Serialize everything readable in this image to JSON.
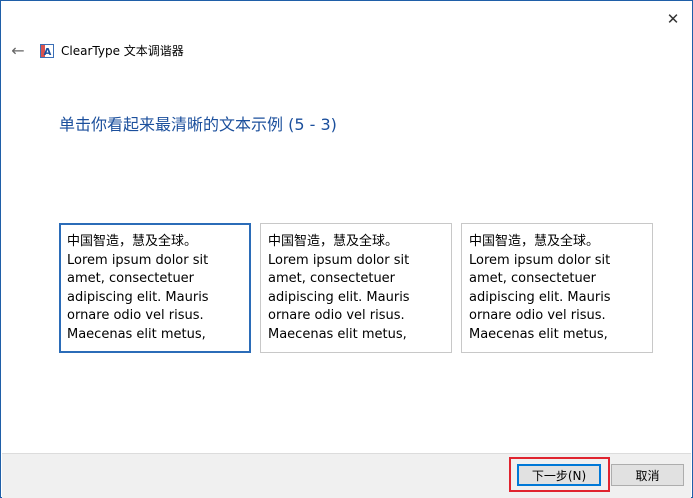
{
  "window": {
    "close_glyph": "✕"
  },
  "header": {
    "back_glyph": "←",
    "app_title": "ClearType 文本调谐器",
    "app_icon_letter": "A"
  },
  "main": {
    "instruction": "单击你看起来最清晰的文本示例 (5 - 3)",
    "samples": [
      {
        "text": "中国智造，慧及全球。\nLorem ipsum dolor sit amet, consectetuer adipiscing elit. Mauris ornare odio vel risus. Maecenas elit metus,",
        "selected": true
      },
      {
        "text": "中国智造，慧及全球。\nLorem ipsum dolor sit amet, consectetuer adipiscing elit. Mauris ornare odio vel risus. Maecenas elit metus,",
        "selected": false
      },
      {
        "text": "中国智造，慧及全球。\nLorem ipsum dolor sit amet, consectetuer adipiscing elit. Mauris ornare odio vel risus. Maecenas elit metus,",
        "selected": false
      }
    ]
  },
  "footer": {
    "next_label": "下一步(N)",
    "cancel_label": "取消"
  },
  "colors": {
    "accent": "#1b4f9c",
    "selection_border": "#2b6cb8",
    "highlight": "#e0242f"
  }
}
